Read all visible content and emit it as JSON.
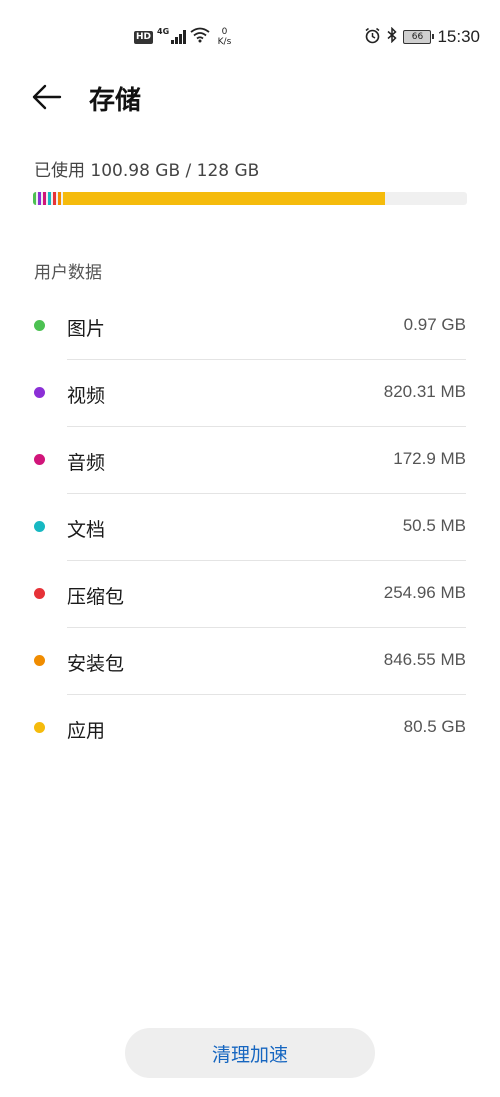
{
  "status_bar": {
    "hd": "HD",
    "network": "4G",
    "speed_value": "0",
    "speed_unit": "K/s",
    "battery": "66",
    "time": "15:30",
    "icons": [
      "signal-icon",
      "wifi-icon",
      "alarm-icon",
      "bluetooth-icon",
      "battery-icon"
    ]
  },
  "header": {
    "title": "存储",
    "back_icon": "arrow-left-icon"
  },
  "usage": {
    "text": "已使用 100.98 GB / 128 GB",
    "used_fraction": 0.789,
    "segments": [
      {
        "color": "#4cc152",
        "share": 0.008
      },
      {
        "color": "#8b2fd6",
        "share": 0.008
      },
      {
        "color": "#d1157a",
        "share": 0.008
      },
      {
        "color": "#17b8c2",
        "share": 0.008
      },
      {
        "color": "#e63238",
        "share": 0.008
      },
      {
        "color": "#f08c00",
        "share": 0.008
      },
      {
        "color": "#f5bb0c",
        "share": 0.741
      }
    ]
  },
  "section_title": "用户数据",
  "items": [
    {
      "label": "图片",
      "size": "0.97 GB",
      "color": "#4cc152"
    },
    {
      "label": "视频",
      "size": "820.31 MB",
      "color": "#8b2fd6"
    },
    {
      "label": "音频",
      "size": "172.9 MB",
      "color": "#d1157a"
    },
    {
      "label": "文档",
      "size": "50.5 MB",
      "color": "#17b8c2"
    },
    {
      "label": "压缩包",
      "size": "254.96 MB",
      "color": "#e63238"
    },
    {
      "label": "安装包",
      "size": "846.55 MB",
      "color": "#f08c00"
    },
    {
      "label": "应用",
      "size": "80.5 GB",
      "color": "#f5bb0c"
    }
  ],
  "clean_button": "清理加速"
}
